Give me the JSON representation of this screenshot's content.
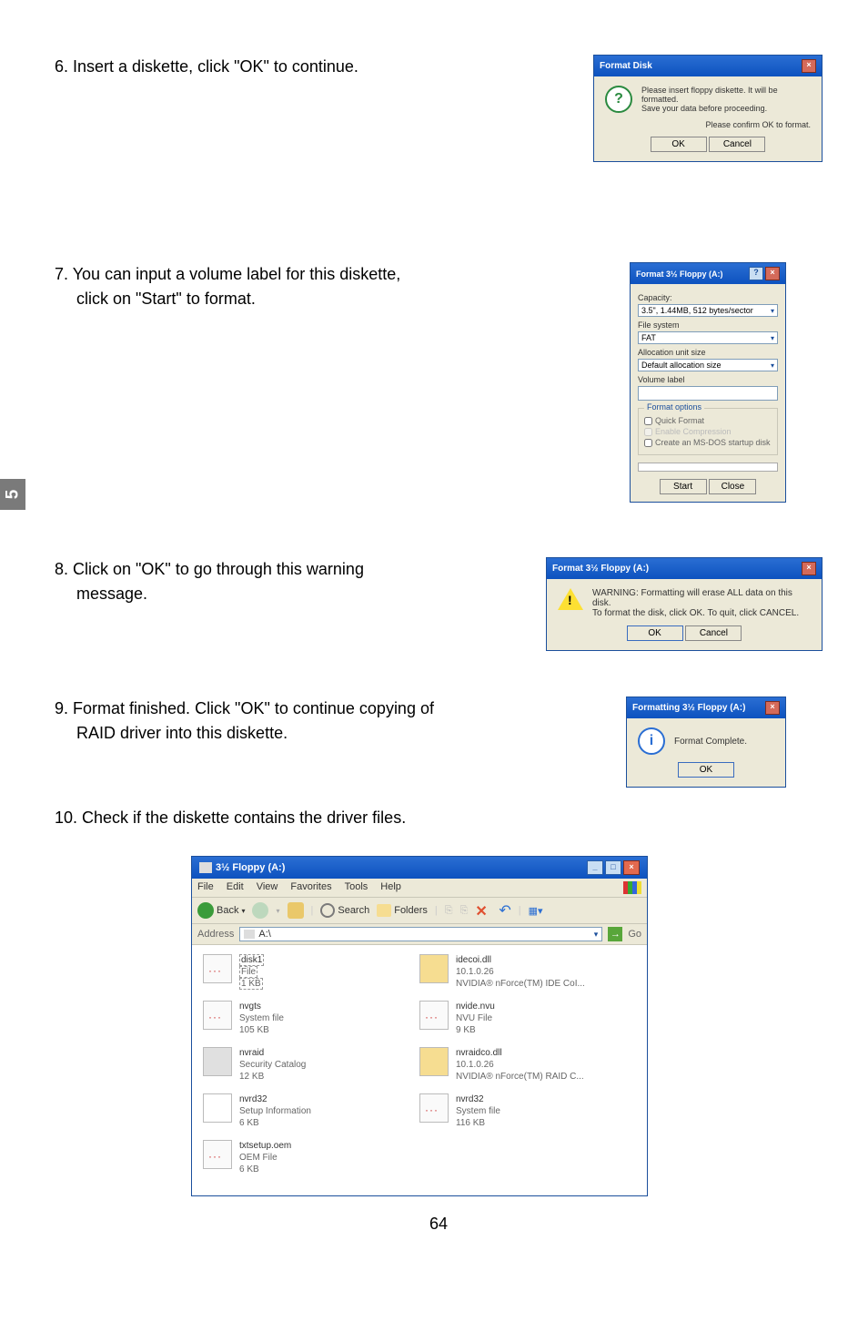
{
  "side_tab": "5",
  "steps": {
    "s6": "6. Insert a diskette, click \"OK\" to continue.",
    "s7a": "7. You can input a volume label for this diskette,",
    "s7b": "click on \"Start\" to format.",
    "s8a": "8. Click on \"OK\" to go through this warning",
    "s8b": "message.",
    "s9a": "9. Format finished. Click \"OK\" to continue copying of",
    "s9b": "RAID driver into this diskette.",
    "s10": "10. Check if the diskette contains the driver files."
  },
  "dlg6": {
    "title": "Format Disk",
    "line1": "Please insert floppy diskette.  It will be formatted.",
    "line2": "Save your data before proceeding.",
    "line3": "Please confirm OK to format.",
    "ok": "OK",
    "cancel": "Cancel"
  },
  "dlg7": {
    "title": "Format 3½ Floppy (A:)",
    "cap_label": "Capacity:",
    "cap_val": "3.5\", 1.44MB, 512 bytes/sector",
    "fs_label": "File system",
    "fs_val": "FAT",
    "au_label": "Allocation unit size",
    "au_val": "Default allocation size",
    "vl_label": "Volume label",
    "grp": "Format options",
    "opt1": "Quick Format",
    "opt2": "Enable Compression",
    "opt3": "Create an MS-DOS startup disk",
    "start": "Start",
    "close": "Close"
  },
  "dlg8": {
    "title": "Format 3½ Floppy (A:)",
    "line1": "WARNING: Formatting will erase ALL data on this disk.",
    "line2": "To format the disk, click OK. To quit, click CANCEL.",
    "ok": "OK",
    "cancel": "Cancel"
  },
  "dlg9": {
    "title": "Formatting 3½ Floppy (A:)",
    "msg": "Format Complete.",
    "ok": "OK"
  },
  "explorer": {
    "title": "3½ Floppy (A:)",
    "menu": {
      "file": "File",
      "edit": "Edit",
      "view": "View",
      "fav": "Favorites",
      "tools": "Tools",
      "help": "Help"
    },
    "tb": {
      "back": "Back",
      "search": "Search",
      "folders": "Folders"
    },
    "addr_label": "Address",
    "addr_val": "A:\\",
    "go": "Go",
    "files": [
      {
        "name": "disk1",
        "t": "File",
        "s": "1 KB",
        "k": "sys",
        "sel": true
      },
      {
        "name": "idecoi.dll",
        "t": "10.1.0.26",
        "s": "NVIDIA® nForce(TM) IDE CoI...",
        "k": "dll"
      },
      {
        "name": "nvgts",
        "t": "System file",
        "s": "105 KB",
        "k": "sys"
      },
      {
        "name": "nvide.nvu",
        "t": "NVU File",
        "s": "9 KB",
        "k": "sys"
      },
      {
        "name": "nvraid",
        "t": "Security Catalog",
        "s": "12 KB",
        "k": "cat"
      },
      {
        "name": "nvraidco.dll",
        "t": "10.1.0.26",
        "s": "NVIDIA® nForce(TM) RAID C...",
        "k": "dll"
      },
      {
        "name": "nvrd32",
        "t": "Setup Information",
        "s": "6 KB",
        "k": "inf"
      },
      {
        "name": "nvrd32",
        "t": "System file",
        "s": "116 KB",
        "k": "sys"
      },
      {
        "name": "txtsetup.oem",
        "t": "OEM File",
        "s": "6 KB",
        "k": "sys"
      }
    ]
  },
  "page_num": "64"
}
